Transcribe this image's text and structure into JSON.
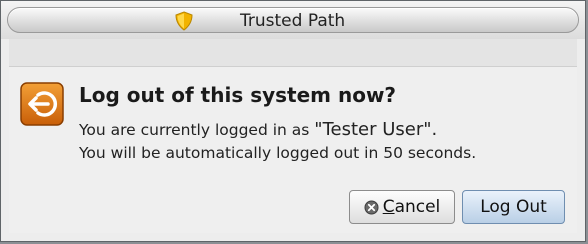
{
  "window": {
    "title": "Trusted Path",
    "shield_icon": "shield-icon",
    "accent": "#f2b300"
  },
  "dialog": {
    "icon": "logout-icon",
    "icon_color": "#e07a12",
    "heading": "Log out of this system now?",
    "message_line1_prefix": "You are currently logged in as ",
    "message_line1_user": "\"Tester User\".",
    "message_line2": "You will be automatically logged out in 50 seconds.",
    "countdown_seconds": 50
  },
  "buttons": {
    "cancel": {
      "mnemonic": "C",
      "rest": "ancel",
      "icon": "cancel-icon"
    },
    "logout": {
      "label": "Log Out"
    }
  }
}
